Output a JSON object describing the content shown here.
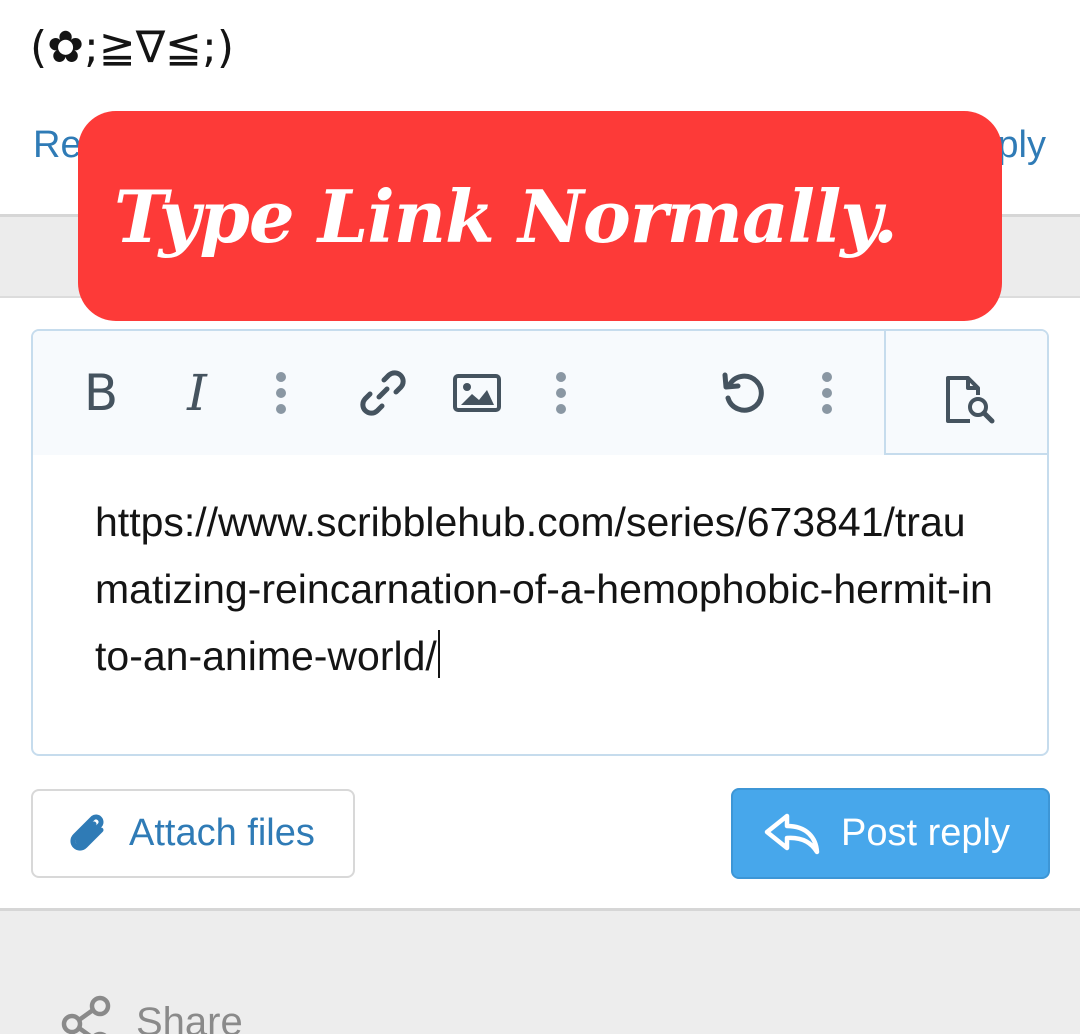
{
  "post": {
    "kaomoji": "(✿;≧∇≦;)",
    "react_label": "React",
    "reply_label": "Reply"
  },
  "banner": {
    "text": "Type Link Normally."
  },
  "editor": {
    "toolbar": {
      "bold_label": "B",
      "italic_label": "I"
    },
    "content": "https://www.scribblehub.com/series/673841/traumatizing-reincarnation-of-a-hemophobic-hermit-into-an-anime-world/"
  },
  "actions": {
    "attach_label": "Attach files",
    "post_label": "Post reply"
  },
  "footer": {
    "share_label": "Share"
  },
  "colors": {
    "banner_bg": "#fd3a38",
    "link_blue": "#2f7bb6",
    "primary_button": "#47a7eb",
    "icon_grey": "#45535f"
  }
}
